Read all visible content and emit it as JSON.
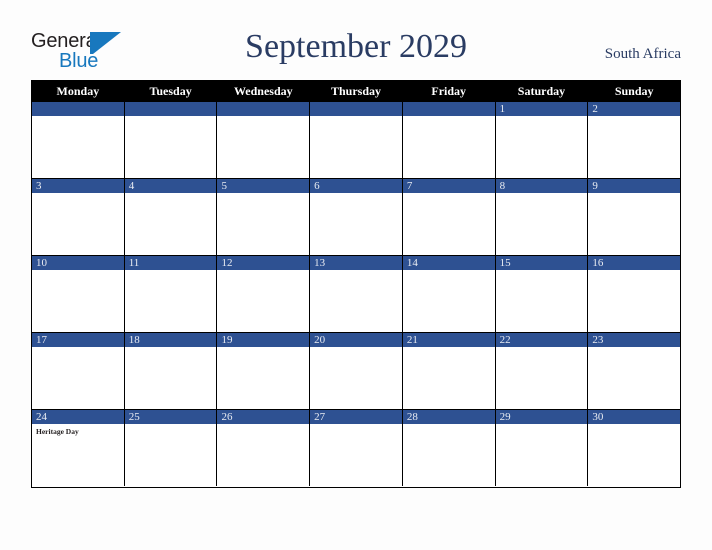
{
  "brand": {
    "name_top": "General",
    "name_bottom": "Blue",
    "accent_color": "#1878be",
    "flag_icon": "flag-triangle-icon"
  },
  "header": {
    "title": "September 2029",
    "country": "South Africa",
    "title_color": "#2a3c63"
  },
  "calendar": {
    "header_bg": "#000000",
    "date_band_bg": "#2e5192",
    "weekdays": [
      "Monday",
      "Tuesday",
      "Wednesday",
      "Thursday",
      "Friday",
      "Saturday",
      "Sunday"
    ],
    "weeks": [
      [
        {
          "day": "",
          "events": []
        },
        {
          "day": "",
          "events": []
        },
        {
          "day": "",
          "events": []
        },
        {
          "day": "",
          "events": []
        },
        {
          "day": "",
          "events": []
        },
        {
          "day": "1",
          "events": []
        },
        {
          "day": "2",
          "events": []
        }
      ],
      [
        {
          "day": "3",
          "events": []
        },
        {
          "day": "4",
          "events": []
        },
        {
          "day": "5",
          "events": []
        },
        {
          "day": "6",
          "events": []
        },
        {
          "day": "7",
          "events": []
        },
        {
          "day": "8",
          "events": []
        },
        {
          "day": "9",
          "events": []
        }
      ],
      [
        {
          "day": "10",
          "events": []
        },
        {
          "day": "11",
          "events": []
        },
        {
          "day": "12",
          "events": []
        },
        {
          "day": "13",
          "events": []
        },
        {
          "day": "14",
          "events": []
        },
        {
          "day": "15",
          "events": []
        },
        {
          "day": "16",
          "events": []
        }
      ],
      [
        {
          "day": "17",
          "events": []
        },
        {
          "day": "18",
          "events": []
        },
        {
          "day": "19",
          "events": []
        },
        {
          "day": "20",
          "events": []
        },
        {
          "day": "21",
          "events": []
        },
        {
          "day": "22",
          "events": []
        },
        {
          "day": "23",
          "events": []
        }
      ],
      [
        {
          "day": "24",
          "events": [
            "Heritage Day"
          ]
        },
        {
          "day": "25",
          "events": []
        },
        {
          "day": "26",
          "events": []
        },
        {
          "day": "27",
          "events": []
        },
        {
          "day": "28",
          "events": []
        },
        {
          "day": "29",
          "events": []
        },
        {
          "day": "30",
          "events": []
        }
      ]
    ]
  }
}
